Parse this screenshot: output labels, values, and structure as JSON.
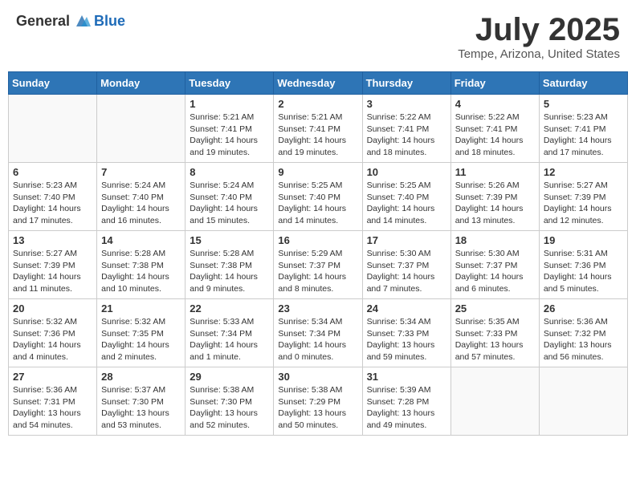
{
  "header": {
    "logo_general": "General",
    "logo_blue": "Blue",
    "month_title": "July 2025",
    "location": "Tempe, Arizona, United States"
  },
  "days_of_week": [
    "Sunday",
    "Monday",
    "Tuesday",
    "Wednesday",
    "Thursday",
    "Friday",
    "Saturday"
  ],
  "weeks": [
    [
      {
        "day": "",
        "info": ""
      },
      {
        "day": "",
        "info": ""
      },
      {
        "day": "1",
        "sunrise": "Sunrise: 5:21 AM",
        "sunset": "Sunset: 7:41 PM",
        "daylight": "Daylight: 14 hours and 19 minutes."
      },
      {
        "day": "2",
        "sunrise": "Sunrise: 5:21 AM",
        "sunset": "Sunset: 7:41 PM",
        "daylight": "Daylight: 14 hours and 19 minutes."
      },
      {
        "day": "3",
        "sunrise": "Sunrise: 5:22 AM",
        "sunset": "Sunset: 7:41 PM",
        "daylight": "Daylight: 14 hours and 18 minutes."
      },
      {
        "day": "4",
        "sunrise": "Sunrise: 5:22 AM",
        "sunset": "Sunset: 7:41 PM",
        "daylight": "Daylight: 14 hours and 18 minutes."
      },
      {
        "day": "5",
        "sunrise": "Sunrise: 5:23 AM",
        "sunset": "Sunset: 7:41 PM",
        "daylight": "Daylight: 14 hours and 17 minutes."
      }
    ],
    [
      {
        "day": "6",
        "sunrise": "Sunrise: 5:23 AM",
        "sunset": "Sunset: 7:40 PM",
        "daylight": "Daylight: 14 hours and 17 minutes."
      },
      {
        "day": "7",
        "sunrise": "Sunrise: 5:24 AM",
        "sunset": "Sunset: 7:40 PM",
        "daylight": "Daylight: 14 hours and 16 minutes."
      },
      {
        "day": "8",
        "sunrise": "Sunrise: 5:24 AM",
        "sunset": "Sunset: 7:40 PM",
        "daylight": "Daylight: 14 hours and 15 minutes."
      },
      {
        "day": "9",
        "sunrise": "Sunrise: 5:25 AM",
        "sunset": "Sunset: 7:40 PM",
        "daylight": "Daylight: 14 hours and 14 minutes."
      },
      {
        "day": "10",
        "sunrise": "Sunrise: 5:25 AM",
        "sunset": "Sunset: 7:40 PM",
        "daylight": "Daylight: 14 hours and 14 minutes."
      },
      {
        "day": "11",
        "sunrise": "Sunrise: 5:26 AM",
        "sunset": "Sunset: 7:39 PM",
        "daylight": "Daylight: 14 hours and 13 minutes."
      },
      {
        "day": "12",
        "sunrise": "Sunrise: 5:27 AM",
        "sunset": "Sunset: 7:39 PM",
        "daylight": "Daylight: 14 hours and 12 minutes."
      }
    ],
    [
      {
        "day": "13",
        "sunrise": "Sunrise: 5:27 AM",
        "sunset": "Sunset: 7:39 PM",
        "daylight": "Daylight: 14 hours and 11 minutes."
      },
      {
        "day": "14",
        "sunrise": "Sunrise: 5:28 AM",
        "sunset": "Sunset: 7:38 PM",
        "daylight": "Daylight: 14 hours and 10 minutes."
      },
      {
        "day": "15",
        "sunrise": "Sunrise: 5:28 AM",
        "sunset": "Sunset: 7:38 PM",
        "daylight": "Daylight: 14 hours and 9 minutes."
      },
      {
        "day": "16",
        "sunrise": "Sunrise: 5:29 AM",
        "sunset": "Sunset: 7:37 PM",
        "daylight": "Daylight: 14 hours and 8 minutes."
      },
      {
        "day": "17",
        "sunrise": "Sunrise: 5:30 AM",
        "sunset": "Sunset: 7:37 PM",
        "daylight": "Daylight: 14 hours and 7 minutes."
      },
      {
        "day": "18",
        "sunrise": "Sunrise: 5:30 AM",
        "sunset": "Sunset: 7:37 PM",
        "daylight": "Daylight: 14 hours and 6 minutes."
      },
      {
        "day": "19",
        "sunrise": "Sunrise: 5:31 AM",
        "sunset": "Sunset: 7:36 PM",
        "daylight": "Daylight: 14 hours and 5 minutes."
      }
    ],
    [
      {
        "day": "20",
        "sunrise": "Sunrise: 5:32 AM",
        "sunset": "Sunset: 7:36 PM",
        "daylight": "Daylight: 14 hours and 4 minutes."
      },
      {
        "day": "21",
        "sunrise": "Sunrise: 5:32 AM",
        "sunset": "Sunset: 7:35 PM",
        "daylight": "Daylight: 14 hours and 2 minutes."
      },
      {
        "day": "22",
        "sunrise": "Sunrise: 5:33 AM",
        "sunset": "Sunset: 7:34 PM",
        "daylight": "Daylight: 14 hours and 1 minute."
      },
      {
        "day": "23",
        "sunrise": "Sunrise: 5:34 AM",
        "sunset": "Sunset: 7:34 PM",
        "daylight": "Daylight: 14 hours and 0 minutes."
      },
      {
        "day": "24",
        "sunrise": "Sunrise: 5:34 AM",
        "sunset": "Sunset: 7:33 PM",
        "daylight": "Daylight: 13 hours and 59 minutes."
      },
      {
        "day": "25",
        "sunrise": "Sunrise: 5:35 AM",
        "sunset": "Sunset: 7:33 PM",
        "daylight": "Daylight: 13 hours and 57 minutes."
      },
      {
        "day": "26",
        "sunrise": "Sunrise: 5:36 AM",
        "sunset": "Sunset: 7:32 PM",
        "daylight": "Daylight: 13 hours and 56 minutes."
      }
    ],
    [
      {
        "day": "27",
        "sunrise": "Sunrise: 5:36 AM",
        "sunset": "Sunset: 7:31 PM",
        "daylight": "Daylight: 13 hours and 54 minutes."
      },
      {
        "day": "28",
        "sunrise": "Sunrise: 5:37 AM",
        "sunset": "Sunset: 7:30 PM",
        "daylight": "Daylight: 13 hours and 53 minutes."
      },
      {
        "day": "29",
        "sunrise": "Sunrise: 5:38 AM",
        "sunset": "Sunset: 7:30 PM",
        "daylight": "Daylight: 13 hours and 52 minutes."
      },
      {
        "day": "30",
        "sunrise": "Sunrise: 5:38 AM",
        "sunset": "Sunset: 7:29 PM",
        "daylight": "Daylight: 13 hours and 50 minutes."
      },
      {
        "day": "31",
        "sunrise": "Sunrise: 5:39 AM",
        "sunset": "Sunset: 7:28 PM",
        "daylight": "Daylight: 13 hours and 49 minutes."
      },
      {
        "day": "",
        "info": ""
      },
      {
        "day": "",
        "info": ""
      }
    ]
  ]
}
